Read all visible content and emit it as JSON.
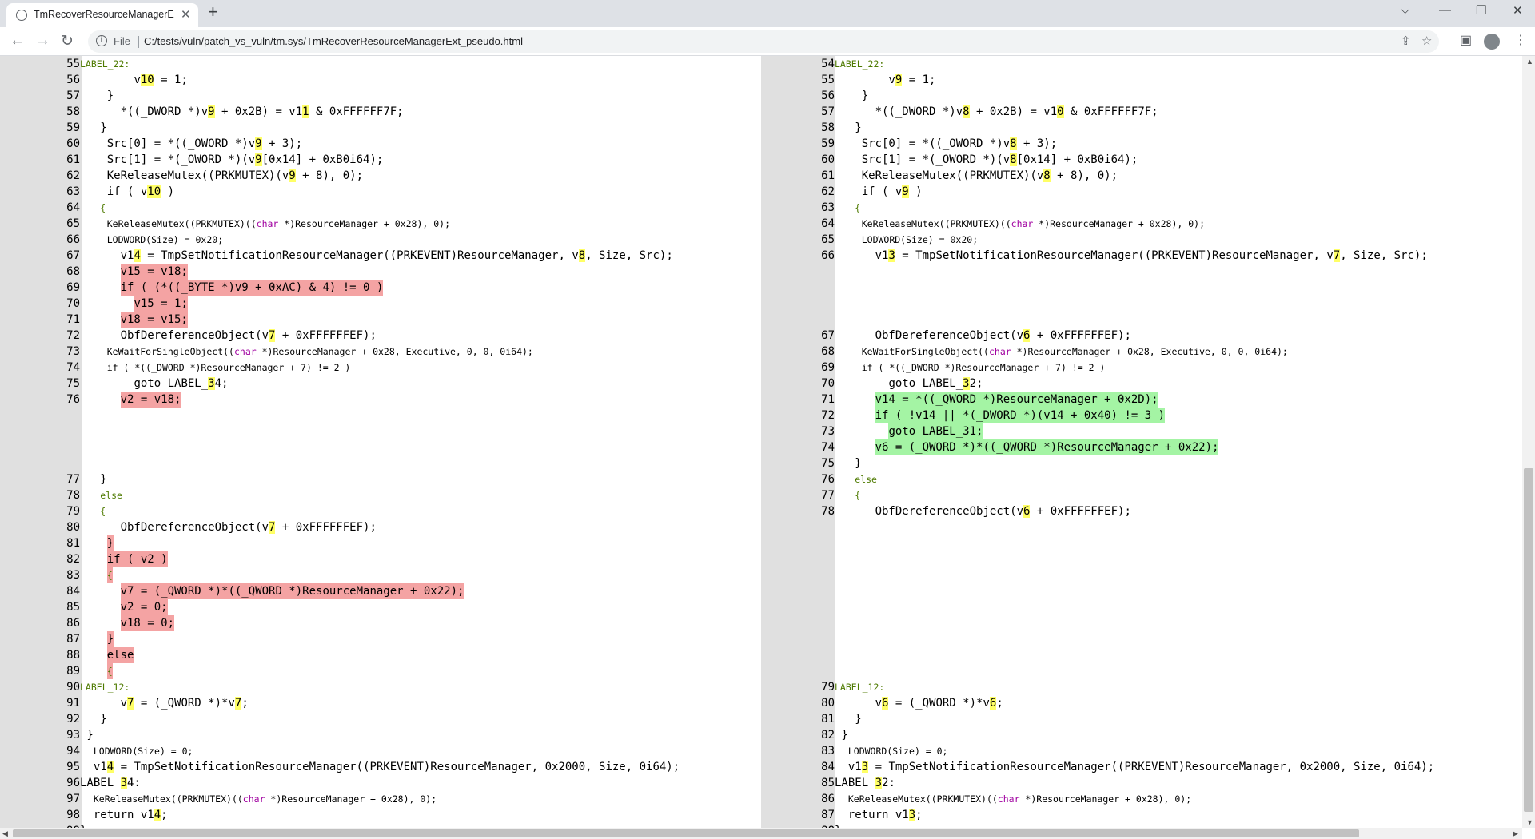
{
  "browser": {
    "tab_title": "TmRecoverResourceManagerExt_",
    "tab_close": "✕",
    "new_tab": "+",
    "min": "⌵",
    "minimize": "—",
    "restore": "❐",
    "close": "✕",
    "back": "←",
    "forward": "→",
    "reload": "↻",
    "file_label": "File",
    "info_glyph": "i",
    "url": "C:/tests/vuln/patch_vs_vuln/tm.sys/TmRecoverResourceManagerExt_pseudo.html",
    "share_icon": "⇪",
    "star_icon": "☆",
    "sidepanel_icon": "▣",
    "menu_icon": "⋮"
  },
  "colors": {
    "deleted": "#f4a3a3",
    "added": "#a4f4a4",
    "highlight": "#ffff66"
  },
  "left_lines": [
    {
      "n": "55",
      "t": [
        [
          "LABEL_22:",
          "kw"
        ]
      ],
      "indent": 0,
      "s": 1
    },
    {
      "n": "56",
      "t": [
        [
          "v"
        ],
        [
          "10",
          "hl"
        ],
        [
          " = 1;"
        ]
      ],
      "indent": 8
    },
    {
      "n": "57",
      "t": [
        [
          "}"
        ]
      ],
      "indent": 4
    },
    {
      "n": "58",
      "t": [
        [
          "*((_DWORD *)v"
        ],
        [
          "9",
          "hl"
        ],
        [
          " + 0x2B) = v1"
        ],
        [
          "1",
          "hl"
        ],
        [
          " & 0xFFFFFF7F;"
        ]
      ],
      "indent": 6
    },
    {
      "n": "59",
      "t": [
        [
          "}"
        ]
      ],
      "indent": 3
    },
    {
      "n": "60",
      "t": [
        [
          "Src[0] = *((_OWORD *)v"
        ],
        [
          "9",
          "hl"
        ],
        [
          " + 3);"
        ]
      ],
      "indent": 4
    },
    {
      "n": "61",
      "t": [
        [
          "Src[1] = *(_OWORD *)(v"
        ],
        [
          "9",
          "hl"
        ],
        [
          "[0x14] + 0xB0i64);"
        ]
      ],
      "indent": 4
    },
    {
      "n": "62",
      "t": [
        [
          "KeReleaseMutex((PRKMUTEX)(v"
        ],
        [
          "9",
          "hl"
        ],
        [
          " + 8), 0);"
        ]
      ],
      "indent": 4
    },
    {
      "n": "63",
      "t": [
        [
          "if ( v"
        ],
        [
          "10",
          "hl"
        ],
        [
          " )"
        ]
      ],
      "indent": 4
    },
    {
      "n": "64",
      "t": [
        [
          "{",
          "kw"
        ]
      ],
      "indent": 3,
      "s": 1
    },
    {
      "n": "65",
      "t": [
        [
          "KeReleaseMutex((PRKMUTEX)(("
        ],
        [
          "char",
          "ty"
        ],
        [
          " *)ResourceManager + 0x28), 0);"
        ]
      ],
      "indent": 4,
      "s": 1
    },
    {
      "n": "66",
      "t": [
        [
          "LODWORD(Size) = 0x20;"
        ]
      ],
      "indent": 4,
      "s": 1
    },
    {
      "n": "67",
      "t": [
        [
          "v1"
        ],
        [
          "4",
          "hl"
        ],
        [
          " = TmpSetNotificationResourceManager((PRKEVENT)ResourceManager, v"
        ],
        [
          "8",
          "hl"
        ],
        [
          ", Size, Src);"
        ]
      ],
      "indent": 6
    },
    {
      "n": "68",
      "t": [
        [
          "v15 = v18;"
        ]
      ],
      "indent": 6,
      "d": "del"
    },
    {
      "n": "69",
      "t": [
        [
          "if ( (*((_BYTE *)v9 + 0xAC) & 4) != 0 )"
        ]
      ],
      "indent": 6,
      "d": "del"
    },
    {
      "n": "70",
      "t": [
        [
          "v15 = 1;"
        ]
      ],
      "indent": 8,
      "d": "del"
    },
    {
      "n": "71",
      "t": [
        [
          "v18 = v15;"
        ]
      ],
      "indent": 6,
      "d": "del"
    },
    {
      "n": "72",
      "t": [
        [
          "ObfDereferenceObject(v"
        ],
        [
          "7",
          "hl"
        ],
        [
          " + 0xFFFFFFEF);"
        ]
      ],
      "indent": 6
    },
    {
      "n": "73",
      "t": [
        [
          "KeWaitForSingleObject(("
        ],
        [
          "char",
          "ty"
        ],
        [
          " *)ResourceManager + 0x28, Executive, 0, 0, 0i64);"
        ]
      ],
      "indent": 4,
      "s": 1
    },
    {
      "n": "74",
      "t": [
        [
          "if ( *((_DWORD *)ResourceManager + 7) != 2 )"
        ]
      ],
      "indent": 4,
      "s": 1
    },
    {
      "n": "75",
      "t": [
        [
          "goto LABEL_"
        ],
        [
          "3",
          "hl"
        ],
        [
          "4;"
        ]
      ],
      "indent": 8
    },
    {
      "n": "76",
      "t": [
        [
          "v2 = v18;"
        ]
      ],
      "indent": 6,
      "d": "del"
    },
    {
      "n": "",
      "t": []
    },
    {
      "n": "",
      "t": []
    },
    {
      "n": "",
      "t": []
    },
    {
      "n": "",
      "t": []
    },
    {
      "n": "77",
      "t": [
        [
          "}"
        ]
      ],
      "indent": 3
    },
    {
      "n": "78",
      "t": [
        [
          "else",
          "kw"
        ]
      ],
      "indent": 3,
      "s": 1
    },
    {
      "n": "79",
      "t": [
        [
          "{",
          "kw"
        ]
      ],
      "indent": 3,
      "s": 1
    },
    {
      "n": "80",
      "t": [
        [
          "ObfDereferenceObject(v"
        ],
        [
          "7",
          "hl"
        ],
        [
          " + 0xFFFFFFEF);"
        ]
      ],
      "indent": 6
    },
    {
      "n": "81",
      "t": [
        [
          "}"
        ]
      ],
      "indent": 4,
      "d": "del"
    },
    {
      "n": "82",
      "t": [
        [
          "if ( v2 )"
        ]
      ],
      "indent": 4,
      "d": "del"
    },
    {
      "n": "83",
      "t": [
        [
          "{",
          "kw"
        ]
      ],
      "indent": 4,
      "d": "del",
      "s": 1
    },
    {
      "n": "84",
      "t": [
        [
          "v7 = (_QWORD *)*((_QWORD *)ResourceManager + 0x22);"
        ]
      ],
      "indent": 6,
      "d": "del"
    },
    {
      "n": "85",
      "t": [
        [
          "v2 = 0;"
        ]
      ],
      "indent": 6,
      "d": "del"
    },
    {
      "n": "86",
      "t": [
        [
          "v18 = 0;"
        ]
      ],
      "indent": 6,
      "d": "del"
    },
    {
      "n": "87",
      "t": [
        [
          "}"
        ]
      ],
      "indent": 4,
      "d": "del"
    },
    {
      "n": "88",
      "t": [
        [
          "else"
        ]
      ],
      "indent": 4,
      "d": "del"
    },
    {
      "n": "89",
      "t": [
        [
          "{",
          "kw"
        ]
      ],
      "indent": 4,
      "d": "del",
      "s": 1
    },
    {
      "n": "90",
      "t": [
        [
          "LABEL_12:",
          "kw"
        ]
      ],
      "indent": 0,
      "s": 1
    },
    {
      "n": "91",
      "t": [
        [
          "v"
        ],
        [
          "7",
          "hl"
        ],
        [
          " = (_QWORD *)*v"
        ],
        [
          "7",
          "hl"
        ],
        [
          ";"
        ]
      ],
      "indent": 6
    },
    {
      "n": "92",
      "t": [
        [
          "}"
        ]
      ],
      "indent": 3
    },
    {
      "n": "93",
      "t": [
        [
          "}"
        ]
      ],
      "indent": 1
    },
    {
      "n": "94",
      "t": [
        [
          "LODWORD(Size) = 0;"
        ]
      ],
      "indent": 2,
      "s": 1
    },
    {
      "n": "95",
      "t": [
        [
          "v1"
        ],
        [
          "4",
          "hl"
        ],
        [
          " = TmpSetNotificationResourceManager((PRKEVENT)ResourceManager, 0x2000, Size, 0i64);"
        ]
      ],
      "indent": 2
    },
    {
      "n": "96",
      "t": [
        [
          "LABEL_"
        ],
        [
          "3",
          "hl"
        ],
        [
          "4:"
        ]
      ],
      "indent": 0
    },
    {
      "n": "97",
      "t": [
        [
          "KeReleaseMutex((PRKMUTEX)(("
        ],
        [
          "char",
          "ty"
        ],
        [
          " *)ResourceManager + 0x28), 0);"
        ]
      ],
      "indent": 2,
      "s": 1
    },
    {
      "n": "98",
      "t": [
        [
          "return v1"
        ],
        [
          "4",
          "hl"
        ],
        [
          ";"
        ]
      ],
      "indent": 2
    },
    {
      "n": "99",
      "t": [
        [
          "}"
        ]
      ],
      "indent": 0
    }
  ],
  "right_lines": [
    {
      "n": "54",
      "t": [
        [
          "LABEL_22:",
          "kw"
        ]
      ],
      "indent": 0,
      "s": 1
    },
    {
      "n": "55",
      "t": [
        [
          "v"
        ],
        [
          "9",
          "hl"
        ],
        [
          " = 1;"
        ]
      ],
      "indent": 8
    },
    {
      "n": "56",
      "t": [
        [
          "}"
        ]
      ],
      "indent": 4
    },
    {
      "n": "57",
      "t": [
        [
          "*((_DWORD *)v"
        ],
        [
          "8",
          "hl"
        ],
        [
          " + 0x2B) = v1"
        ],
        [
          "0",
          "hl"
        ],
        [
          " & 0xFFFFFF7F;"
        ]
      ],
      "indent": 6
    },
    {
      "n": "58",
      "t": [
        [
          "}"
        ]
      ],
      "indent": 3
    },
    {
      "n": "59",
      "t": [
        [
          "Src[0] = *((_OWORD *)v"
        ],
        [
          "8",
          "hl"
        ],
        [
          " + 3);"
        ]
      ],
      "indent": 4
    },
    {
      "n": "60",
      "t": [
        [
          "Src[1] = *(_OWORD *)(v"
        ],
        [
          "8",
          "hl"
        ],
        [
          "[0x14] + 0xB0i64);"
        ]
      ],
      "indent": 4
    },
    {
      "n": "61",
      "t": [
        [
          "KeReleaseMutex((PRKMUTEX)(v"
        ],
        [
          "8",
          "hl"
        ],
        [
          " + 8), 0);"
        ]
      ],
      "indent": 4
    },
    {
      "n": "62",
      "t": [
        [
          "if ( v"
        ],
        [
          "9",
          "hl"
        ],
        [
          " )"
        ]
      ],
      "indent": 4
    },
    {
      "n": "63",
      "t": [
        [
          "{",
          "kw"
        ]
      ],
      "indent": 3,
      "s": 1
    },
    {
      "n": "64",
      "t": [
        [
          "KeReleaseMutex((PRKMUTEX)(("
        ],
        [
          "char",
          "ty"
        ],
        [
          " *)ResourceManager + 0x28), 0);"
        ]
      ],
      "indent": 4,
      "s": 1
    },
    {
      "n": "65",
      "t": [
        [
          "LODWORD(Size) = 0x20;"
        ]
      ],
      "indent": 4,
      "s": 1
    },
    {
      "n": "66",
      "t": [
        [
          "v1"
        ],
        [
          "3",
          "hl"
        ],
        [
          " = TmpSetNotificationResourceManager((PRKEVENT)ResourceManager, v"
        ],
        [
          "7",
          "hl"
        ],
        [
          ", Size, Src);"
        ]
      ],
      "indent": 6
    },
    {
      "n": "",
      "t": []
    },
    {
      "n": "",
      "t": []
    },
    {
      "n": "",
      "t": []
    },
    {
      "n": "",
      "t": []
    },
    {
      "n": "67",
      "t": [
        [
          "ObfDereferenceObject(v"
        ],
        [
          "6",
          "hl"
        ],
        [
          " + 0xFFFFFFEF);"
        ]
      ],
      "indent": 6
    },
    {
      "n": "68",
      "t": [
        [
          "KeWaitForSingleObject(("
        ],
        [
          "char",
          "ty"
        ],
        [
          " *)ResourceManager + 0x28, Executive, 0, 0, 0i64);"
        ]
      ],
      "indent": 4,
      "s": 1
    },
    {
      "n": "69",
      "t": [
        [
          "if ( *((_DWORD *)ResourceManager + 7) != 2 )"
        ]
      ],
      "indent": 4,
      "s": 1
    },
    {
      "n": "70",
      "t": [
        [
          "goto LABEL_"
        ],
        [
          "3",
          "hl"
        ],
        [
          "2;"
        ]
      ],
      "indent": 8
    },
    {
      "n": "71",
      "t": [
        [
          "v14 = *((_QWORD *)ResourceManager + 0x2D);"
        ]
      ],
      "indent": 6,
      "d": "add"
    },
    {
      "n": "72",
      "t": [
        [
          "if ( !v14 || *(_DWORD *)(v14 + 0x40) != 3 )"
        ]
      ],
      "indent": 6,
      "d": "add"
    },
    {
      "n": "73",
      "t": [
        [
          "goto LABEL_31;"
        ]
      ],
      "indent": 8,
      "d": "add"
    },
    {
      "n": "74",
      "t": [
        [
          "v6 = (_QWORD *)*((_QWORD *)ResourceManager + 0x22);"
        ]
      ],
      "indent": 6,
      "d": "add"
    },
    {
      "n": "75",
      "t": [
        [
          "}"
        ]
      ],
      "indent": 3
    },
    {
      "n": "76",
      "t": [
        [
          "else",
          "kw"
        ]
      ],
      "indent": 3,
      "s": 1
    },
    {
      "n": "77",
      "t": [
        [
          "{",
          "kw"
        ]
      ],
      "indent": 3,
      "s": 1
    },
    {
      "n": "78",
      "t": [
        [
          "ObfDereferenceObject(v"
        ],
        [
          "6",
          "hl"
        ],
        [
          " + 0xFFFFFFEF);"
        ]
      ],
      "indent": 6
    },
    {
      "n": "",
      "t": []
    },
    {
      "n": "",
      "t": []
    },
    {
      "n": "",
      "t": []
    },
    {
      "n": "",
      "t": []
    },
    {
      "n": "",
      "t": []
    },
    {
      "n": "",
      "t": []
    },
    {
      "n": "",
      "t": []
    },
    {
      "n": "",
      "t": []
    },
    {
      "n": "",
      "t": []
    },
    {
      "n": "",
      "t": []
    },
    {
      "n": "79",
      "t": [
        [
          "LABEL_12:",
          "kw"
        ]
      ],
      "indent": 0,
      "s": 1
    },
    {
      "n": "80",
      "t": [
        [
          "v"
        ],
        [
          "6",
          "hl"
        ],
        [
          " = (_QWORD *)*v"
        ],
        [
          "6",
          "hl"
        ],
        [
          ";"
        ]
      ],
      "indent": 6
    },
    {
      "n": "81",
      "t": [
        [
          "}"
        ]
      ],
      "indent": 3
    },
    {
      "n": "82",
      "t": [
        [
          "}"
        ]
      ],
      "indent": 1
    },
    {
      "n": "83",
      "t": [
        [
          "LODWORD(Size) = 0;"
        ]
      ],
      "indent": 2,
      "s": 1
    },
    {
      "n": "84",
      "t": [
        [
          "v1"
        ],
        [
          "3",
          "hl"
        ],
        [
          " = TmpSetNotificationResourceManager((PRKEVENT)ResourceManager, 0x2000, Size, 0i64);"
        ]
      ],
      "indent": 2
    },
    {
      "n": "85",
      "t": [
        [
          "LABEL_"
        ],
        [
          "3",
          "hl"
        ],
        [
          "2:"
        ]
      ],
      "indent": 0
    },
    {
      "n": "86",
      "t": [
        [
          "KeReleaseMutex((PRKMUTEX)(("
        ],
        [
          "char",
          "ty"
        ],
        [
          " *)ResourceManager + 0x28), 0);"
        ]
      ],
      "indent": 2,
      "s": 1
    },
    {
      "n": "87",
      "t": [
        [
          "return v1"
        ],
        [
          "3",
          "hl"
        ],
        [
          ";"
        ]
      ],
      "indent": 2
    },
    {
      "n": "88",
      "t": [
        [
          "}"
        ]
      ],
      "indent": 0
    }
  ]
}
